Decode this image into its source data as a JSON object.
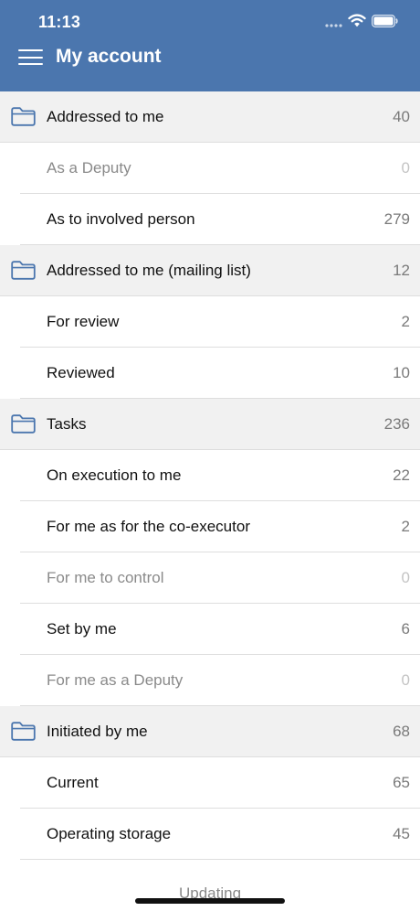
{
  "status_bar": {
    "time": "11:13"
  },
  "header": {
    "title": "My account"
  },
  "colors": {
    "header_bg": "#4b76ae",
    "group_bg": "#f1f1f1",
    "folder_icon": "#4b76ae"
  },
  "rows": [
    {
      "type": "group",
      "label": "Addressed to me",
      "count": "40",
      "icon": "folder-icon"
    },
    {
      "type": "item",
      "label": "As a Deputy",
      "count": "0",
      "disabled": true
    },
    {
      "type": "item",
      "label": "As to involved person",
      "count": "279"
    },
    {
      "type": "group",
      "label": "Addressed to me (mailing list)",
      "count": "12",
      "icon": "folder-icon"
    },
    {
      "type": "item",
      "label": "For review",
      "count": "2"
    },
    {
      "type": "item",
      "label": "Reviewed",
      "count": "10"
    },
    {
      "type": "group",
      "label": "Tasks",
      "count": "236",
      "icon": "folder-icon"
    },
    {
      "type": "item",
      "label": "On execution to me",
      "count": "22"
    },
    {
      "type": "item",
      "label": "For me as for the co-executor",
      "count": "2"
    },
    {
      "type": "item",
      "label": "For me to control",
      "count": "0",
      "disabled": true
    },
    {
      "type": "item",
      "label": "Set by me",
      "count": "6"
    },
    {
      "type": "item",
      "label": "For me as a Deputy",
      "count": "0",
      "disabled": true
    },
    {
      "type": "group",
      "label": "Initiated by me",
      "count": "68",
      "icon": "folder-icon"
    },
    {
      "type": "item",
      "label": "Current",
      "count": "65"
    },
    {
      "type": "item",
      "label": "Operating storage",
      "count": "45"
    },
    {
      "type": "group",
      "label": "",
      "count": "",
      "icon": "folder-icon"
    }
  ],
  "footer": {
    "status": "Updating"
  }
}
